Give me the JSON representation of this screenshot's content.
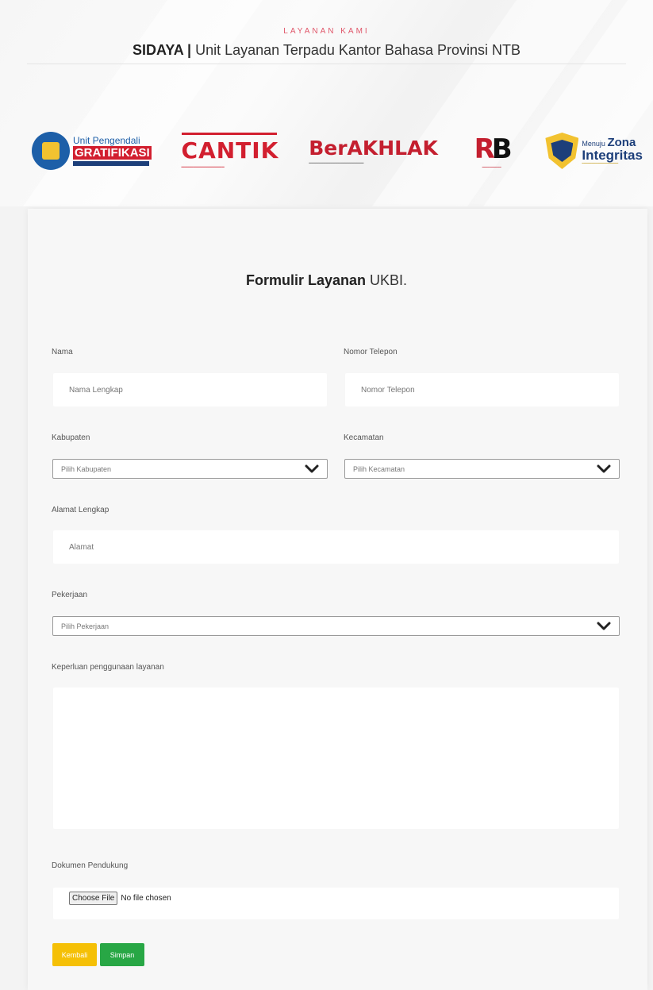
{
  "header": {
    "eyebrow": "LAYANAN KAMI",
    "title_bold": "SIDAYA |",
    "title_rest": " Unit Layanan Terpadu Kantor Bahasa Provinsi NTB"
  },
  "logos": {
    "gratifikasi": {
      "line1": "Unit Pengendali",
      "line2": "GRATIFIKASI"
    },
    "cantik": {
      "text": "CANTIK"
    },
    "berakhlak": {
      "text": "BerAKHLAK"
    },
    "rb": {
      "text_r": "R",
      "text_b": "B"
    },
    "zona": {
      "pre": "Menuju",
      "zona": "Zona",
      "integritas": "Integritas"
    }
  },
  "form": {
    "title_bold": "Formulir Layanan",
    "title_rest": " UKBI.",
    "nama": {
      "label": "Nama",
      "placeholder": "Nama Lengkap"
    },
    "telepon": {
      "label": "Nomor Telepon",
      "placeholder": "Nomor Telepon"
    },
    "kabupaten": {
      "label": "Kabupaten",
      "selected": "Pilih Kabupaten"
    },
    "kecamatan": {
      "label": "Kecamatan",
      "selected": "Pilih Kecamatan"
    },
    "alamat": {
      "label": "Alamat Lengkap",
      "placeholder": "Alamat"
    },
    "pekerjaan": {
      "label": "Pekerjaan",
      "selected": "Pilih Pekerjaan"
    },
    "keperluan": {
      "label": "Keperluan penggunaan layanan",
      "value": ""
    },
    "dokumen": {
      "label": "Dokumen Pendukung",
      "button": "Choose File",
      "status": "No file chosen"
    },
    "buttons": {
      "back": "Kembali",
      "save": "Simpan"
    }
  },
  "colors": {
    "accent_red": "#e0576a",
    "back_button": "#f5c006",
    "save_button": "#28a745"
  }
}
